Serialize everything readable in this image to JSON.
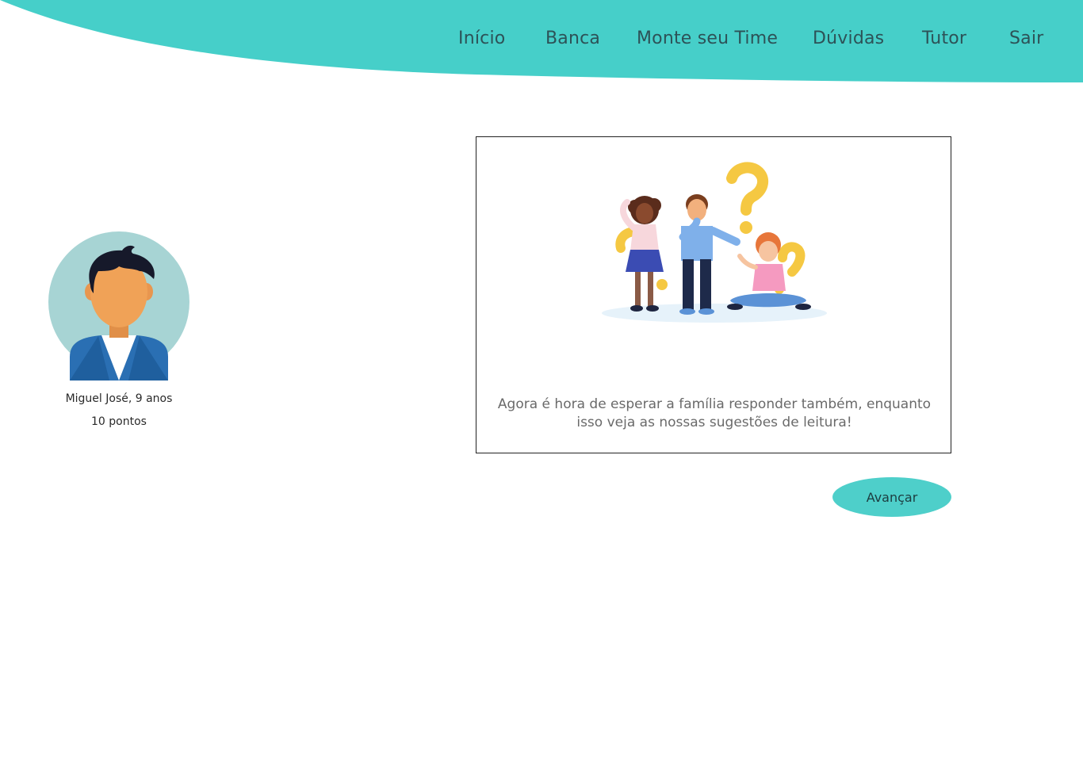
{
  "colors": {
    "header": "#46cfc9",
    "button": "#4ecfca",
    "nav_text": "#2d5257",
    "avatar_bg": "#a7d4d4"
  },
  "nav": {
    "items": [
      {
        "label": "Início"
      },
      {
        "label": "Banca"
      },
      {
        "label": "Monte seu Time"
      },
      {
        "label": "Dúvidas"
      },
      {
        "label": "Tutor"
      },
      {
        "label": "Sair"
      }
    ]
  },
  "profile": {
    "name": "Miguel José, 9 anos",
    "points": "10 pontos",
    "avatar_icon": "boy-avatar-icon"
  },
  "card": {
    "illustration": "family-question-marks-illustration",
    "message": "Agora é hora de esperar a família responder também, enquanto isso veja as nossas sugestões de leitura!"
  },
  "actions": {
    "advance_label": "Avançar"
  }
}
